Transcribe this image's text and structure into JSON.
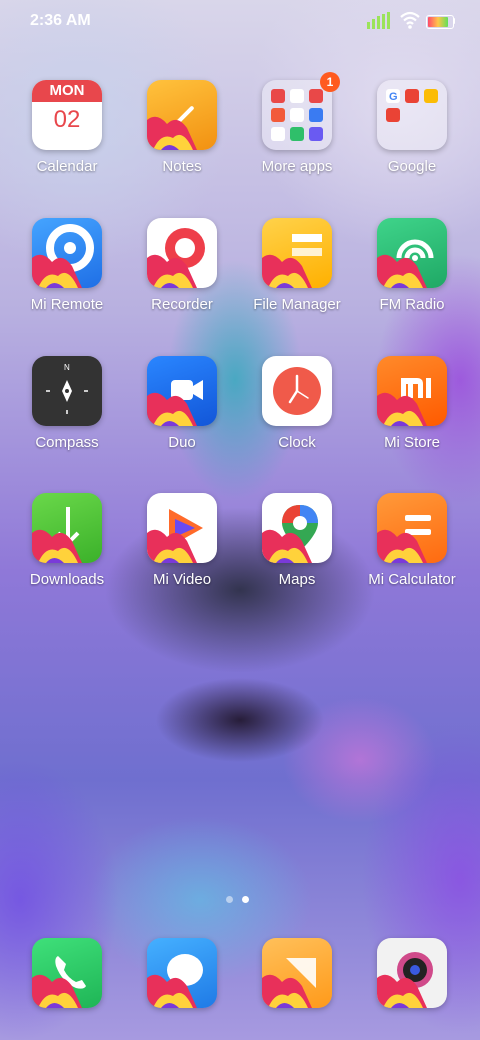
{
  "status": {
    "time": "2:36 AM",
    "battery_level": 0.85
  },
  "calendar": {
    "weekday": "MON",
    "day": "02"
  },
  "more_apps": {
    "badge_count": "1"
  },
  "apps": [
    {
      "label": "Calendar",
      "icon": "calendar-icon",
      "color": "#ffffff"
    },
    {
      "label": "Notes",
      "icon": "notes-icon",
      "color": "#f5a623"
    },
    {
      "label": "More apps",
      "icon": "folder-icon",
      "color": "#ffffff"
    },
    {
      "label": "Google",
      "icon": "folder-icon",
      "color": "#ffffff"
    },
    {
      "label": "Mi Remote",
      "icon": "remote-icon",
      "color": "#2f8cff"
    },
    {
      "label": "Recorder",
      "icon": "recorder-icon",
      "color": "#ffffff"
    },
    {
      "label": "File Manager",
      "icon": "folder-file-icon",
      "color": "#ffb200"
    },
    {
      "label": "FM Radio",
      "icon": "radio-icon",
      "color": "#2ec27e"
    },
    {
      "label": "Compass",
      "icon": "compass-icon",
      "color": "#333333"
    },
    {
      "label": "Duo",
      "icon": "video-camera-icon",
      "color": "#1a73e8"
    },
    {
      "label": "Clock",
      "icon": "clock-icon",
      "color": "#ffffff"
    },
    {
      "label": "Mi Store",
      "icon": "mi-logo-icon",
      "color": "#ff6a00"
    },
    {
      "label": "Downloads",
      "icon": "download-icon",
      "color": "#5cc93a"
    },
    {
      "label": "Mi Video",
      "icon": "play-icon",
      "color": "#ffffff"
    },
    {
      "label": "Maps",
      "icon": "map-pin-icon",
      "color": "#ffffff"
    },
    {
      "label": "Mi Calculator",
      "icon": "calculator-icon",
      "color": "#ff7a1a"
    }
  ],
  "dock": [
    {
      "name": "phone",
      "icon": "phone-icon",
      "color": "#2fcf6a"
    },
    {
      "name": "messages",
      "icon": "message-icon",
      "color": "#2f9bff"
    },
    {
      "name": "gallery",
      "icon": "gallery-icon",
      "color": "#ffb340"
    },
    {
      "name": "camera",
      "icon": "camera-icon",
      "color": "#f2f2f2"
    }
  ]
}
